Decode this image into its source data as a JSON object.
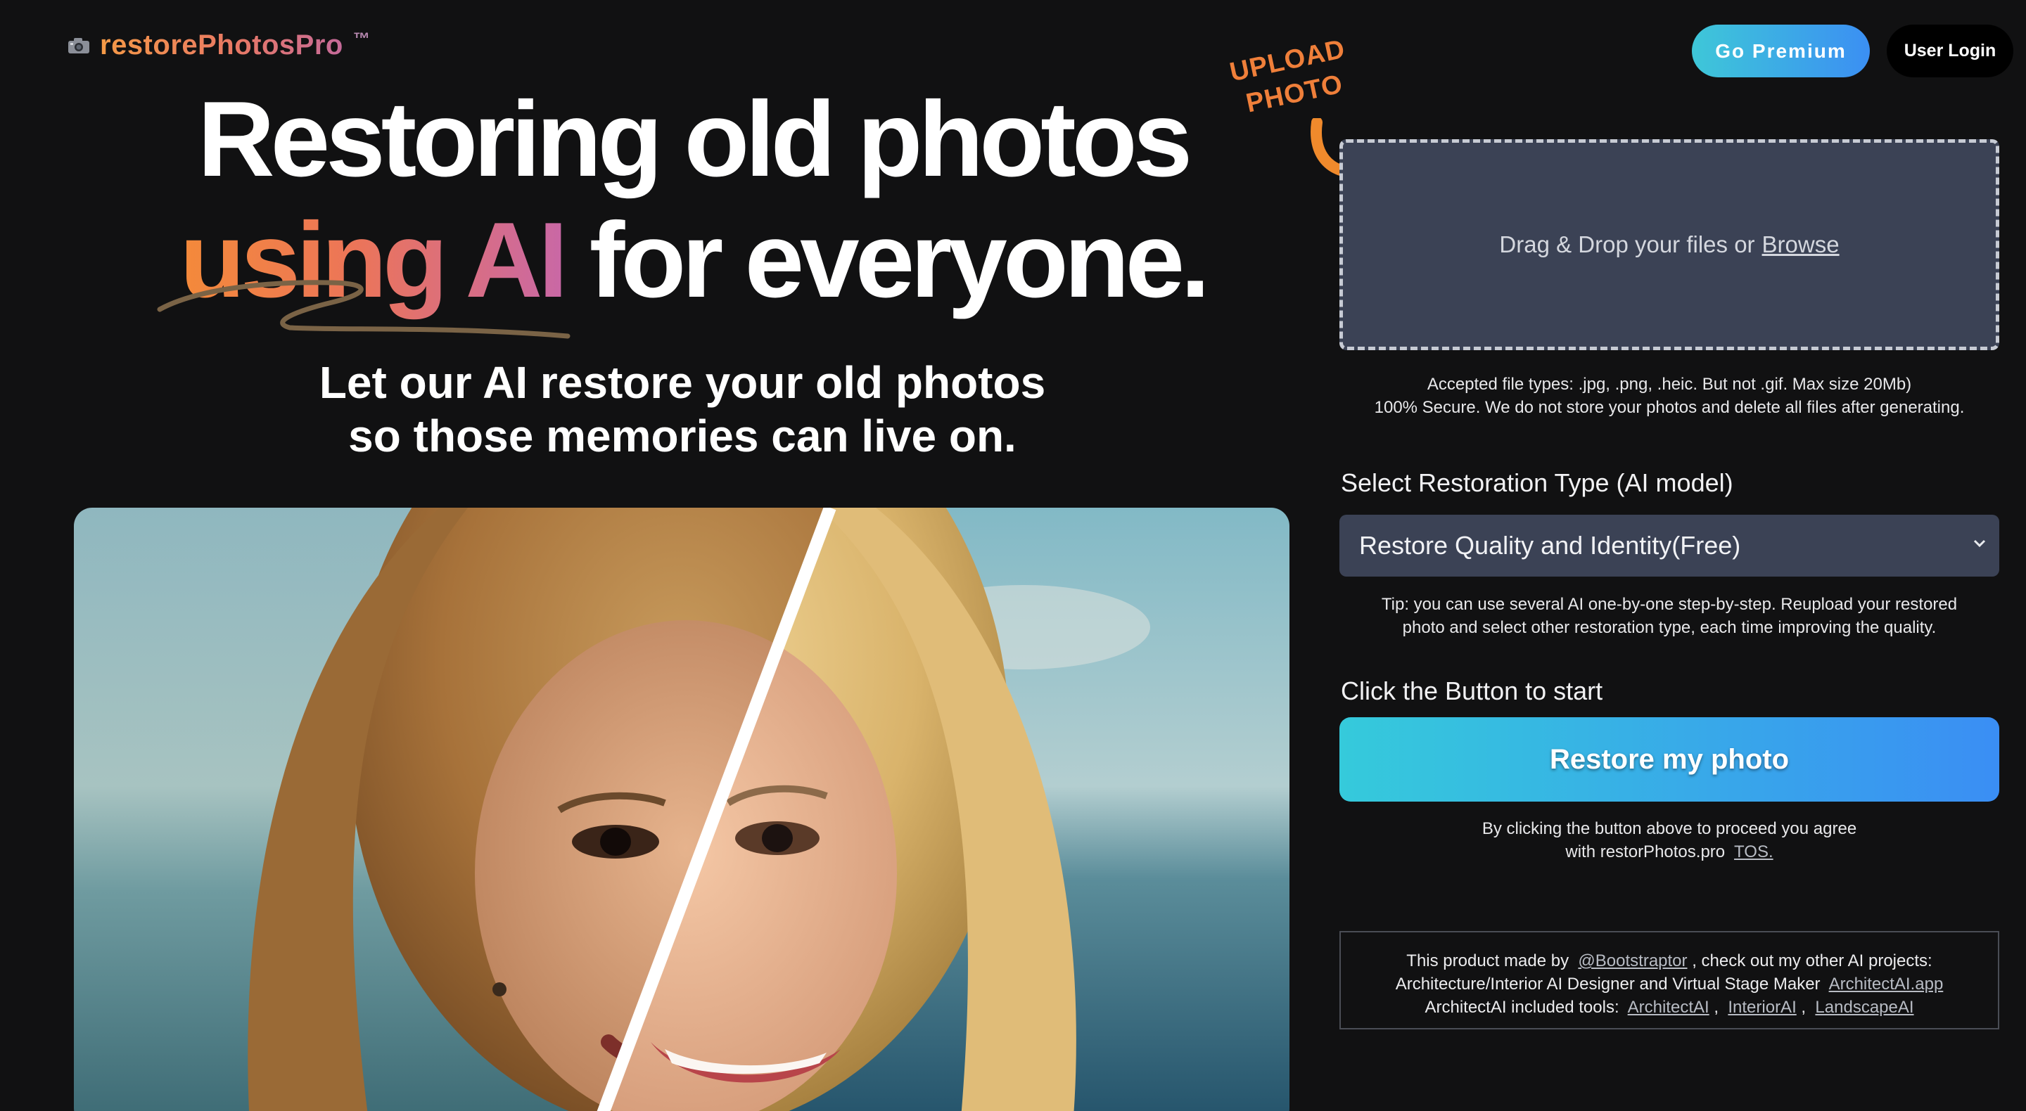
{
  "brand": {
    "name": "restorePhotosPro",
    "trademark": "™",
    "icon": "camera-icon"
  },
  "header": {
    "premium_label": "Go Premium",
    "login_label": "User Login"
  },
  "hero": {
    "line1": "Restoring old photos",
    "line2_highlight": "using AI",
    "line2_rest": "for everyone.",
    "sub_line1": "Let our AI restore your old photos",
    "sub_line2": "so those memories can live on."
  },
  "upload": {
    "label_line1": "UPLOAD",
    "label_line2": "PHOTO",
    "drop_text": "Drag & Drop your files or",
    "browse_label": "Browse",
    "accepted_types": "Accepted file types: .jpg, .png, .heic. But not .gif. Max size 20Mb)",
    "secure_note": "100% Secure. We do not store your photos and delete all files after generating."
  },
  "restoration": {
    "title": "Select Restoration Type (AI model)",
    "selected": "Restore Quality and Identity(Free)",
    "tip_line1": "Tip: you can use several AI one-by-one step-by-step. Reupload your restored",
    "tip_line2": "photo and select other restoration type, each time improving the quality."
  },
  "action": {
    "title": "Click the Button to start",
    "button_label": "Restore my photo",
    "agree_line1": "By clicking the button above to proceed you agree",
    "agree_line2": "with restorPhotos.pro",
    "tos_label": "TOS."
  },
  "credits": {
    "made_by": "This product made by",
    "author": "@Bootstraptor",
    "made_by_rest": ", check out my other AI projects:",
    "line2_text": "Architecture/Interior AI Designer and Virtual Stage Maker",
    "line2_link": "ArchitectAI.app",
    "line3_text": "ArchitectAI included tools:",
    "tools": [
      "ArchitectAI",
      "InteriorAI",
      "LandscapeAI"
    ],
    "separator": ","
  },
  "colors": {
    "background": "#111112",
    "accent_orange": "#ef7f3a",
    "accent_gradient_start": "#3ec7d8",
    "accent_gradient_end": "#3b8ff3",
    "panel": "#3b4255"
  }
}
